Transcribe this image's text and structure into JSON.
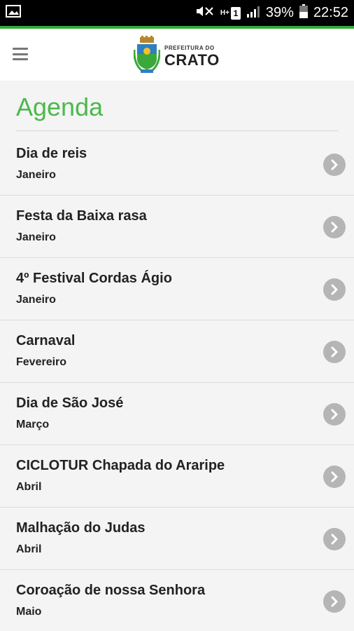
{
  "status_bar": {
    "battery_percent": "39%",
    "time": "22:52",
    "sim_label": "1",
    "signal_label": "H+"
  },
  "header": {
    "logo_small": "PREFEITURA DO",
    "logo_big": "CRATO"
  },
  "page": {
    "title": "Agenda"
  },
  "events": [
    {
      "name": "Dia de reis",
      "month": "Janeiro"
    },
    {
      "name": "Festa da Baixa rasa",
      "month": "Janeiro"
    },
    {
      "name": "4º Festival Cordas Ágio",
      "month": "Janeiro"
    },
    {
      "name": "Carnaval",
      "month": "Fevereiro"
    },
    {
      "name": "Dia de São José",
      "month": "Março"
    },
    {
      "name": "CICLOTUR Chapada do Araripe",
      "month": "Abril"
    },
    {
      "name": "Malhação do Judas",
      "month": "Abril"
    },
    {
      "name": "Coroação de nossa Senhora",
      "month": "Maio"
    }
  ],
  "colors": {
    "accent": "#4cb84c",
    "chevron": "#b5b5b5"
  }
}
